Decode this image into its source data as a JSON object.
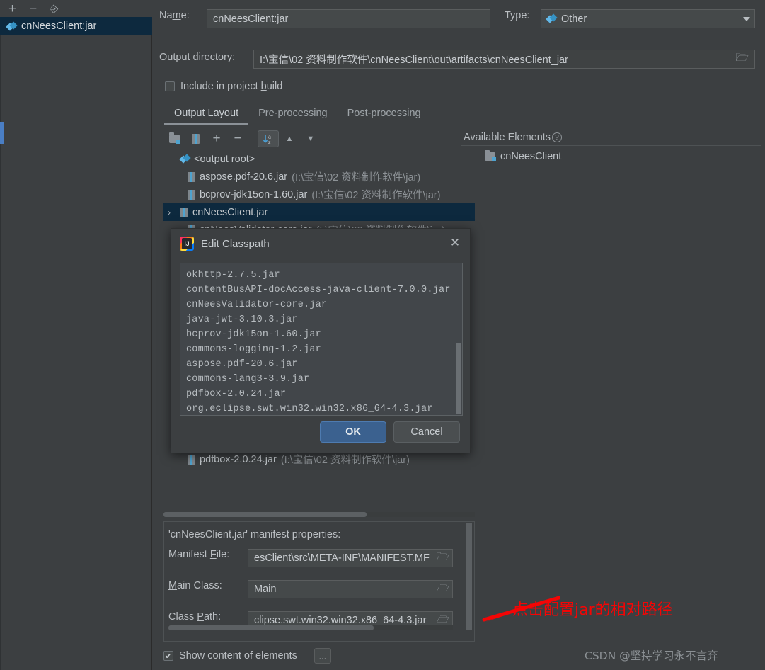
{
  "left_panel": {
    "toolbar": [
      {
        "name": "add-artifact-button",
        "glyph": "+"
      },
      {
        "name": "remove-artifact-button",
        "glyph": "−"
      },
      {
        "name": "copy-artifact-button",
        "glyph": "⎘"
      }
    ],
    "items": [
      {
        "label": "cnNeesClient:jar",
        "icon": "artifact-diamond-icon",
        "selected": true
      }
    ]
  },
  "form": {
    "name_label": "Name:",
    "name_value": "cnNeesClient:jar",
    "type_label": "Type:",
    "type_value": "Other",
    "output_dir_label": "Output directory:",
    "output_dir_value": "I:\\宝信\\02 资料制作软件\\cnNeesClient\\out\\artifacts\\cnNeesClient_jar",
    "include_in_build_label": "Include in project build",
    "include_in_build_checked": false
  },
  "tabs": [
    {
      "label": "Output Layout",
      "active": true
    },
    {
      "label": "Pre-processing",
      "active": false
    },
    {
      "label": "Post-processing",
      "active": false
    }
  ],
  "layout_toolbar": [
    {
      "name": "create-directory-button",
      "glyph": "🗁"
    },
    {
      "name": "create-archive-button",
      "glyph": "jar"
    },
    {
      "name": "add-copy-of-button",
      "glyph": "+"
    },
    {
      "name": "remove-button",
      "glyph": "−"
    },
    {
      "name": "sort-alphabetically-button",
      "glyph": "az",
      "active": true
    },
    {
      "name": "move-up-button",
      "glyph": "▲"
    },
    {
      "name": "move-down-button",
      "glyph": "▼"
    }
  ],
  "tree": [
    {
      "icon": "output-root-icon",
      "label": "<output root>",
      "path": "",
      "depth": 0,
      "selected": false,
      "chevron": ""
    },
    {
      "icon": "jar-icon",
      "label": "aspose.pdf-20.6.jar",
      "path": "(I:\\宝信\\02 资料制作软件\\jar)",
      "depth": 1,
      "selected": false,
      "chevron": ""
    },
    {
      "icon": "jar-icon",
      "label": "bcprov-jdk15on-1.60.jar",
      "path": "(I:\\宝信\\02 资料制作软件\\jar)",
      "depth": 1,
      "selected": false,
      "chevron": ""
    },
    {
      "icon": "jar-icon",
      "label": "cnNeesClient.jar",
      "path": "",
      "depth": 1,
      "selected": true,
      "chevron": "›"
    },
    {
      "icon": "jar-icon",
      "label": "cnNeesValidator-core.jar",
      "path": "(I:\\宝信\\02 资料制作软件\\jar)",
      "depth": 1,
      "selected": false,
      "chevron": ""
    },
    {
      "icon": "jar-icon",
      "label": "pdfbox-2.0.24.jar",
      "path": "(I:\\宝信\\02 资料制作软件\\jar)",
      "depth": 1,
      "selected": false,
      "chevron": ""
    }
  ],
  "available": {
    "title": "Available Elements",
    "help_glyph": "?",
    "items": [
      {
        "icon": "module-folder-icon",
        "label": "cnNeesClient"
      }
    ]
  },
  "manifest": {
    "title": "'cnNeesClient.jar' manifest properties:",
    "rows": [
      {
        "label_pre": "Manifest ",
        "label_key": "F",
        "label_post": "ile:",
        "value": "esClient\\src\\META-INF\\MANIFEST.MF",
        "browse_icon": "folder-open-icon"
      },
      {
        "label_pre": "",
        "label_key": "M",
        "label_post": "ain Class:",
        "value": "Main",
        "browse_icon": "folder-open-icon"
      },
      {
        "label_pre": "Class ",
        "label_key": "P",
        "label_post": "ath:",
        "value": "clipse.swt.win32.win32.x86_64-4.3.jar",
        "browse_icon": "folder-open-icon"
      }
    ]
  },
  "bottom": {
    "show_content_label": "Show content of elements",
    "show_content_checked": true,
    "dots_button_label": "..."
  },
  "dialog": {
    "title": "Edit Classpath",
    "app_icon": "intellij-idea-icon",
    "close_icon": "close-icon",
    "classpath_lines": [
      "okhttp-2.7.5.jar",
      "contentBusAPI-docAccess-java-client-7.0.0.jar",
      "cnNeesValidator-core.jar",
      "java-jwt-3.10.3.jar",
      "bcprov-jdk15on-1.60.jar",
      "commons-logging-1.2.jar",
      "aspose.pdf-20.6.jar",
      "commons-lang3-3.9.jar",
      "pdfbox-2.0.24.jar",
      "org.eclipse.swt.win32.win32.x86_64-4.3.jar"
    ],
    "ok_label": "OK",
    "cancel_label": "Cancel"
  },
  "annotation": {
    "text": "点击配置jar的相对路径",
    "color": "#f40505",
    "arrow_icon": "red-arrow-icon"
  },
  "watermark": {
    "text": "CSDN @坚持学习永不言弃"
  },
  "colors": {
    "background": "#3c3f41",
    "selection": "#0d293e",
    "accent_blue": "#3592c4",
    "primary_button": "#3b618f",
    "annotation_red": "#f40505"
  }
}
